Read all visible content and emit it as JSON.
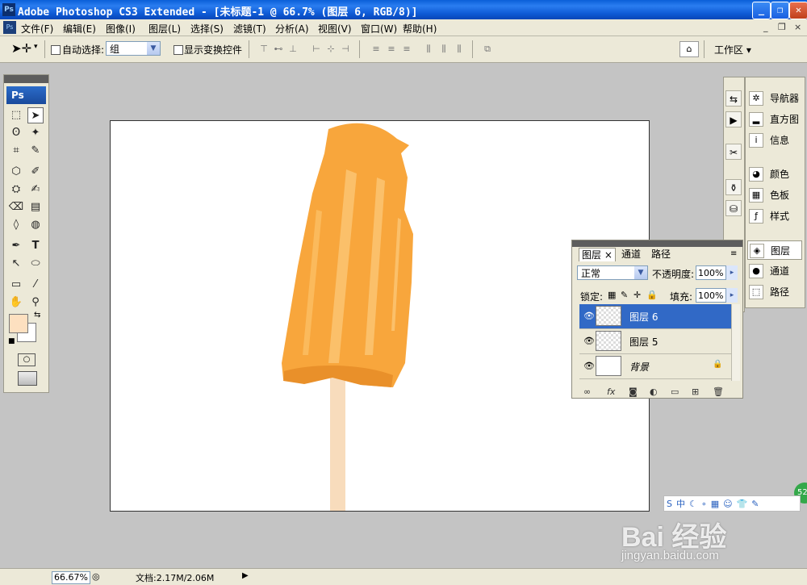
{
  "window": {
    "title": "Adobe Photoshop CS3 Extended - [未标题-1 @ 66.7% (图层 6, RGB/8)]",
    "app_icon": "Ps",
    "controls": {
      "minimize": "_",
      "restore": "❐",
      "close": "✕"
    }
  },
  "menu": {
    "items": [
      "文件(F)",
      "编辑(E)",
      "图像(I)",
      "图层(L)",
      "选择(S)",
      "滤镜(T)",
      "分析(A)",
      "视图(V)",
      "窗口(W)",
      "帮助(H)"
    ],
    "doc_controls": [
      "_",
      "❐",
      "×"
    ]
  },
  "options": {
    "auto_select_label": "自动选择:",
    "auto_select_value": "组",
    "show_transform_label": "显示变换控件",
    "workspace_label": "工作区 ▾"
  },
  "tools": {
    "logo": "Ps",
    "foreground_color": "#fde0c0",
    "background_color": "#ffffff"
  },
  "dock": {
    "items": [
      "导航器",
      "直方图",
      "信息",
      "颜色",
      "色板",
      "样式",
      "图层",
      "通道",
      "路径"
    ]
  },
  "layers_panel": {
    "tabs": [
      "图层 ×",
      "通道",
      "路径"
    ],
    "blend_mode": "正常",
    "opacity_label": "不透明度:",
    "opacity_value": "100%",
    "lock_label": "锁定:",
    "fill_label": "填充:",
    "fill_value": "100%",
    "layers": [
      {
        "name": "图层 6",
        "selected": true
      },
      {
        "name": "图层 5",
        "selected": false
      },
      {
        "name": "背景",
        "selected": false,
        "locked": true
      }
    ]
  },
  "status": {
    "zoom": "66.67%",
    "doc_info": "文档:2.17M/2.06M"
  },
  "watermark": {
    "brand": "Bai 经验",
    "url": "jingyan.baidu.com",
    "badge": "52"
  },
  "colors": {
    "popsicle_main": "#f8a63c",
    "popsicle_light": "#fbc06a",
    "stick": "#f8dcbc",
    "selection_blue": "#3169c6"
  }
}
